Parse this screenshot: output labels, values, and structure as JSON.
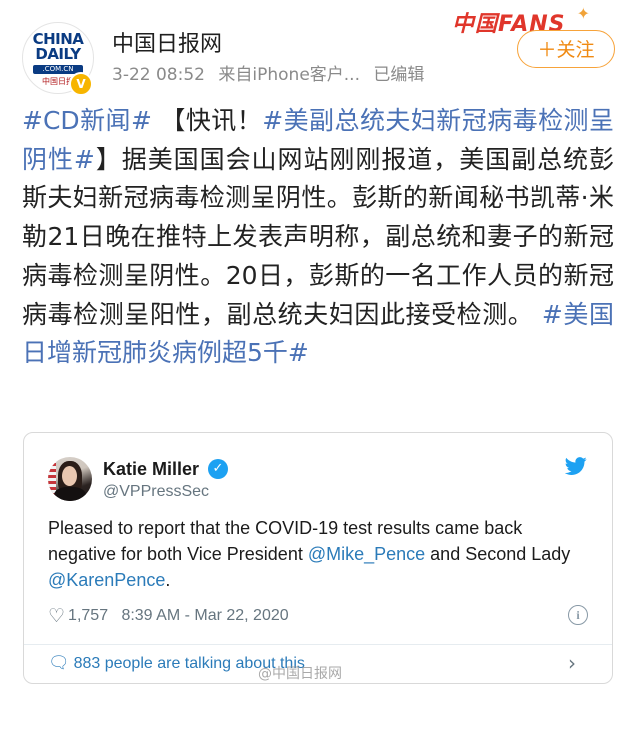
{
  "header": {
    "avatar_logo_text": "CHINA DAILY",
    "avatar_domain": ".COM.CN",
    "avatar_sub": "中国日报",
    "account_name": "中国日报网",
    "timestamp": "3-22 08:52",
    "source": "来自iPhone客户...",
    "edited": "已编辑",
    "banner_text": "中国FANS",
    "follow_label": "＋关注"
  },
  "post": {
    "topic1": "#CD新闻#",
    "flash": " 【快讯！",
    "topic2": "#美副总统夫妇新冠病毒检测呈阴性#",
    "body": "】据美国国会山网站刚刚报道，美国副总统彭斯夫妇新冠病毒检测呈阴性。彭斯的新闻秘书凯蒂·米勒21日晚在推特上发表声明称，副总统和妻子的新冠病毒检测呈阴性。20日，彭斯的一名工作人员的新冠病毒检测呈阳性，副总统夫妇因此接受检测。",
    "topic3": " #美国日增新冠肺炎病例超5千#"
  },
  "tweet": {
    "name": "Katie Miller",
    "handle": "@VPPressSec",
    "text_part1": "Pleased to report that the COVID-19 test results came back negative for both Vice President ",
    "mention1": "@Mike_Pence",
    "text_part2": " and Second Lady ",
    "mention2": "@KarenPence",
    "text_part3": ".",
    "likes": "1,757",
    "time": "8:39 AM - Mar 22, 2020",
    "talking": "883 people are talking about this"
  },
  "watermark": "@中国日报网",
  "colors": {
    "topic_blue": "#4b72b6",
    "follow_orange": "#f08a12",
    "twitter_blue": "#1da1f2",
    "mention_blue": "#2b7bb9"
  }
}
